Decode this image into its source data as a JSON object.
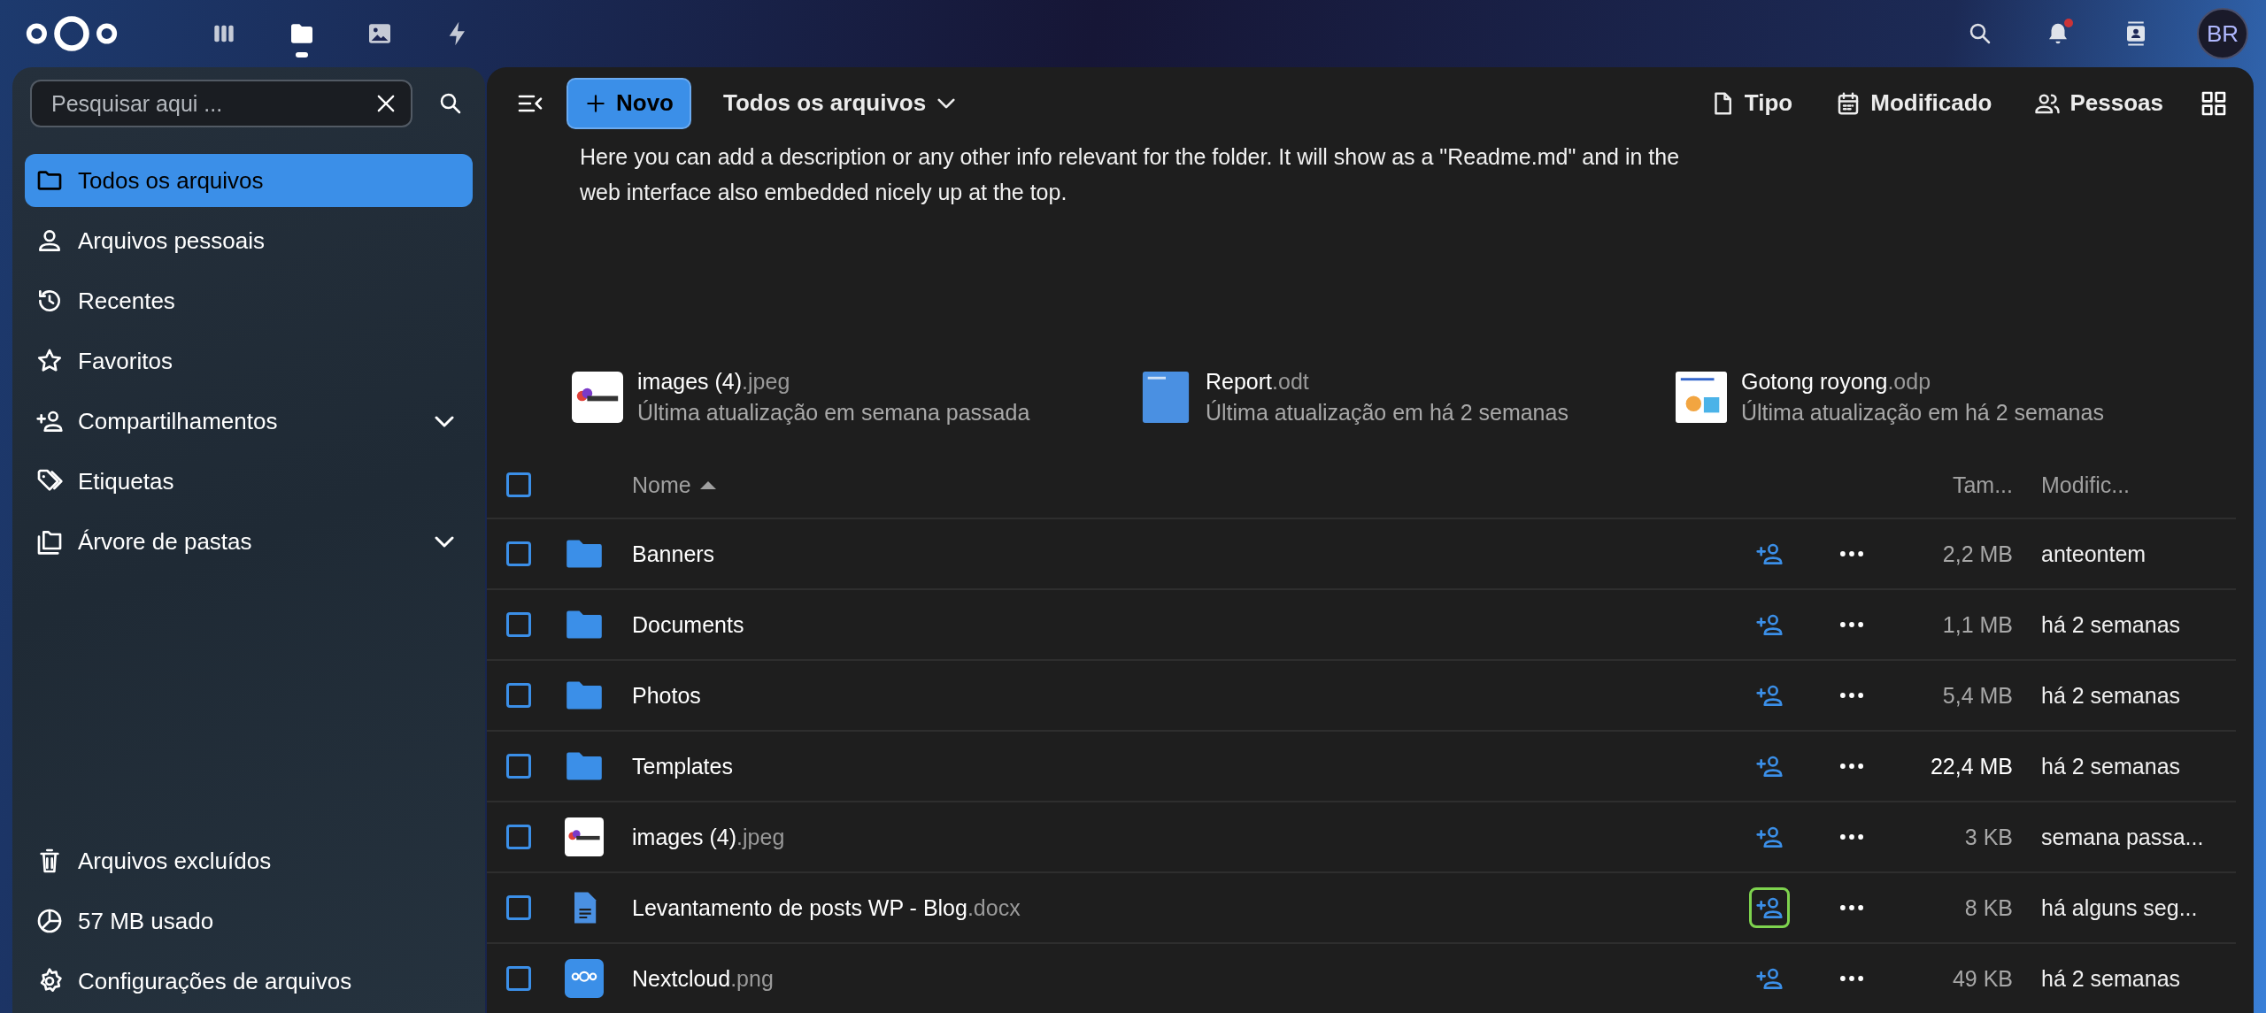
{
  "header": {
    "apps": [
      {
        "kind": "dashboard",
        "selected": false
      },
      {
        "kind": "files",
        "selected": true
      },
      {
        "kind": "photos",
        "selected": false
      },
      {
        "kind": "activity",
        "selected": false
      }
    ],
    "actions": [
      {
        "kind": "search",
        "unread": false
      },
      {
        "kind": "notifications",
        "unread": true
      },
      {
        "kind": "contacts",
        "unread": false
      }
    ],
    "avatar": "BR"
  },
  "sidebar": {
    "search": {
      "placeholder": "Pesquisar aqui ..."
    },
    "items": [
      {
        "kind": "folder",
        "label": "Todos os arquivos",
        "selected": true,
        "expandable": false
      },
      {
        "kind": "person",
        "label": "Arquivos pessoais",
        "selected": false,
        "expandable": false
      },
      {
        "kind": "history",
        "label": "Recentes",
        "selected": false,
        "expandable": false
      },
      {
        "kind": "star",
        "label": "Favoritos",
        "selected": false,
        "expandable": false
      },
      {
        "kind": "share",
        "label": "Compartilhamentos",
        "selected": false,
        "expandable": true
      },
      {
        "kind": "tag",
        "label": "Etiquetas",
        "selected": false,
        "expandable": false
      },
      {
        "kind": "folders",
        "label": "Árvore de pastas",
        "selected": false,
        "expandable": true
      }
    ],
    "footer": [
      {
        "kind": "trash",
        "label": "Arquivos excluídos"
      },
      {
        "kind": "quota",
        "label": "57 MB usado"
      },
      {
        "kind": "gear",
        "label": "Configurações de arquivos"
      }
    ]
  },
  "toolbar": {
    "new_button": "Novo",
    "breadcrumb": "Todos os arquivos",
    "filters": [
      {
        "kind": "type",
        "label": "Tipo"
      },
      {
        "kind": "date",
        "label": "Modificado"
      },
      {
        "kind": "people",
        "label": "Pessoas"
      }
    ]
  },
  "description": "Here you can add a description or any other info relevant for the folder. It will show as a \"Readme.md\" and in the web interface also embedded nicely up at the top.",
  "recent": [
    {
      "kind": "image",
      "name": "images (4)",
      "ext": ".jpeg",
      "updated": "Última atualização em semana passada"
    },
    {
      "kind": "report",
      "name": "Report",
      "ext": ".odt",
      "updated": "Última atualização em há 2 semanas"
    },
    {
      "kind": "slides",
      "name": "Gotong royong",
      "ext": ".odp",
      "updated": "Última atualização em há 2 semanas"
    }
  ],
  "table": {
    "select_all": false,
    "columns": {
      "name": "Nome",
      "size": "Tam...",
      "modified": "Modific..."
    },
    "rows": [
      {
        "kind": "folder",
        "name": "Banners",
        "ext": "",
        "size": "2,2 MB",
        "size_strong": false,
        "modified": "anteontem",
        "focused": false,
        "selected": false
      },
      {
        "kind": "folder",
        "name": "Documents",
        "ext": "",
        "size": "1,1 MB",
        "size_strong": false,
        "modified": "há 2 semanas",
        "focused": false,
        "selected": false
      },
      {
        "kind": "folder",
        "name": "Photos",
        "ext": "",
        "size": "5,4 MB",
        "size_strong": false,
        "modified": "há 2 semanas",
        "focused": false,
        "selected": false
      },
      {
        "kind": "folder",
        "name": "Templates",
        "ext": "",
        "size": "22,4 MB",
        "size_strong": true,
        "modified": "há 2 semanas",
        "focused": false,
        "selected": false
      },
      {
        "kind": "image",
        "name": "images (4)",
        "ext": ".jpeg",
        "size": "3 KB",
        "size_strong": false,
        "modified": "semana passa...",
        "focused": false,
        "selected": false
      },
      {
        "kind": "document",
        "name": "Levantamento de posts WP - Blog",
        "ext": ".docx",
        "size": "8 KB",
        "size_strong": false,
        "modified": "há alguns seg...",
        "focused": true,
        "selected": false
      },
      {
        "kind": "logo",
        "name": "Nextcloud",
        "ext": ".png",
        "size": "49 KB",
        "size_strong": false,
        "modified": "há 2 semanas",
        "focused": false,
        "selected": false
      }
    ]
  }
}
